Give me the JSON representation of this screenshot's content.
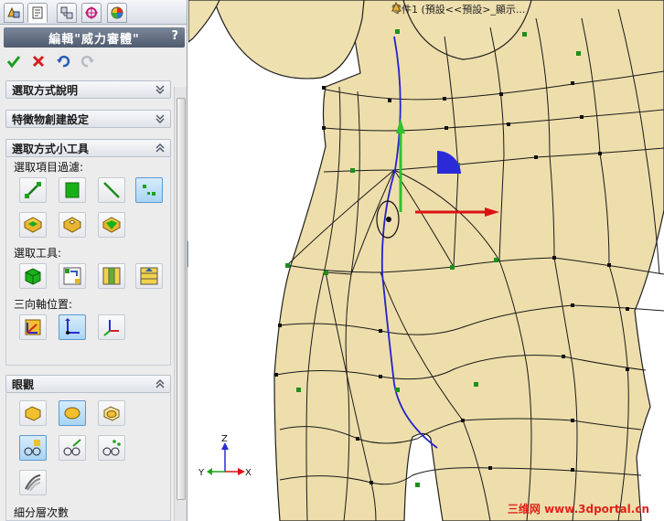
{
  "panel": {
    "title": "編輯\"威力審體\"",
    "help": "?",
    "groups": {
      "selection_help": "選取方式說明",
      "feature_creation": "特徵物創建設定",
      "selection_tools_widget": "選取方式小工具",
      "display": "眼觀"
    },
    "labels": {
      "filter": "選取項目過濾:",
      "tools": "選取工具:",
      "triad": "三向軸位置:",
      "subdiv": "細分層次數"
    }
  },
  "viewport": {
    "doc_title": "零件1 (預設<<預設>_顯示...",
    "axes": {
      "x": "X",
      "y": "Y",
      "z": "Z"
    },
    "watermark": "三维网 www.3dportal.cn"
  },
  "colors": {
    "model_fill": "#eedeab",
    "mesh_line": "#1a1a1a",
    "curve": "#2222cc",
    "vertex_green": "#1e8f1e",
    "triad_x": "#dd1111",
    "triad_y": "#2fc12f",
    "triad_plane": "#2a2ad9",
    "title_bar": "#5c687b"
  }
}
